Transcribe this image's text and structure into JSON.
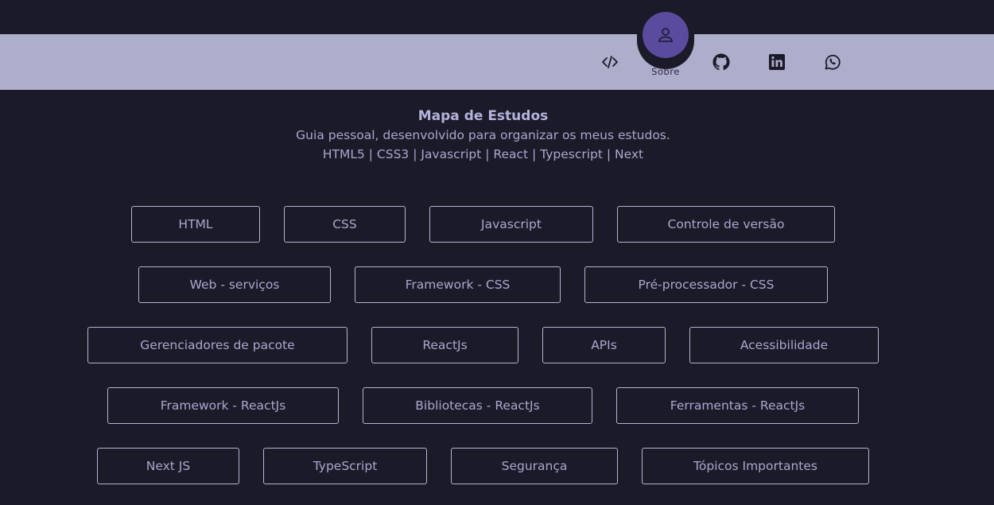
{
  "nav": {
    "items": [
      {
        "icon": "code-icon",
        "label": ""
      },
      {
        "icon": "user-icon",
        "label": "Sobre"
      },
      {
        "icon": "github-icon",
        "label": ""
      },
      {
        "icon": "linkedin-icon",
        "label": ""
      },
      {
        "icon": "whatsapp-icon",
        "label": ""
      }
    ],
    "active_label": "Sobre"
  },
  "header": {
    "title": "Mapa de Estudos",
    "subtitle": "Guia pessoal, desenvolvido para organizar os meus estudos.",
    "tech_list": "HTML5 | CSS3 | Javascript | React | Typescript | Next"
  },
  "topics": {
    "row1": [
      "HTML",
      "CSS",
      "Javascript",
      "Controle de versão"
    ],
    "row2": [
      "Web - serviços",
      "Framework - CSS",
      "Pré-processador - CSS"
    ],
    "row3": [
      "Gerenciadores de pacote",
      "ReactJs",
      "APIs",
      "Acessibilidade"
    ],
    "row4": [
      "Framework - ReactJs",
      "Bibliotecas - ReactJs",
      "Ferramentas - ReactJs"
    ],
    "row5": [
      "Next JS",
      "TypeScript",
      "Segurança",
      "Tópicos Importantes"
    ]
  },
  "colors": {
    "background": "#1b1a28",
    "navbar": "#adadcc",
    "accent": "#5a4b9e",
    "text": "#a8a8d0"
  }
}
